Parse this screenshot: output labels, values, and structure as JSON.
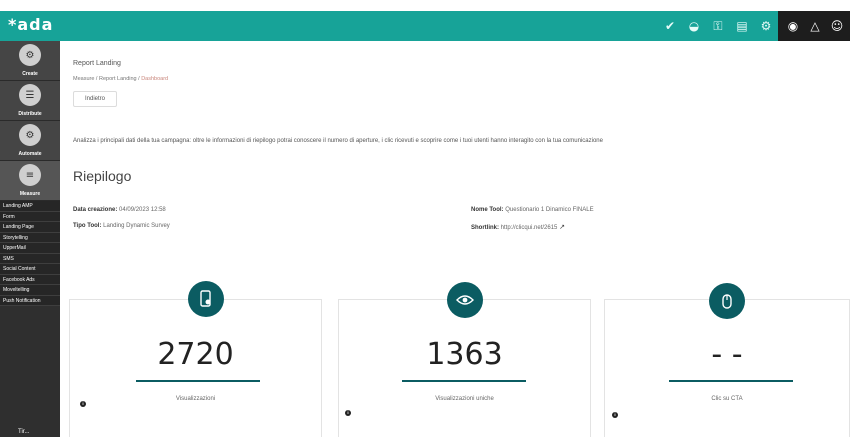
{
  "app": {
    "logo": "*ada"
  },
  "topbar": {
    "icons": [
      "shield-check-icon",
      "dashboard-icon",
      "key-icon",
      "document-icon",
      "gear-icon"
    ],
    "dark_icons": [
      "help-icon",
      "bell-icon",
      "user-icon"
    ]
  },
  "sidebar": {
    "sections": [
      {
        "label": "Create",
        "icon": "palette-icon"
      },
      {
        "label": "Distribute",
        "icon": "list-icon"
      },
      {
        "label": "Automate",
        "icon": "automate-icon"
      },
      {
        "label": "Measure",
        "icon": "measure-icon"
      }
    ],
    "items": [
      "Landing AMP",
      "Form",
      "Landing Page",
      "Storytelling",
      "UpperMail",
      "SMS",
      "Social Content",
      "Facebook Ads",
      "Moveltelling",
      "Push Notification"
    ],
    "bottom_label": "Tir..."
  },
  "page": {
    "title": "Report Landing",
    "breadcrumb": {
      "part1": "Measure / Report Landing / ",
      "current": "Dashboard"
    },
    "back_label": "Indietro",
    "intro": "Analizza i principali dati della tua campagna: oltre le informazioni di riepilogo potrai conoscere il numero di aperture, i clic ricevuti e scoprire come i tuoi utenti hanno interagito con la tua comunicazione",
    "section_title": "Riepilogo"
  },
  "summary": {
    "created_label": "Data creazione:",
    "created_value": "04/09/2023 12:58",
    "type_label": "Tipo Tool:",
    "type_value": "Landing Dynamic Survey",
    "name_label": "Nome Tool:",
    "name_value": "Questionario 1 Dinamico FINALE",
    "shortlink_label": "Shortlink:",
    "shortlink_value": "http://clicqui.net/2615"
  },
  "cards": [
    {
      "value": "2720",
      "label": "Visualizzazioni",
      "icon": "mobile-tap-icon"
    },
    {
      "value": "1363",
      "label": "Visualizzazioni uniche",
      "icon": "eye-icon"
    },
    {
      "value": "- -",
      "label": "Clic su CTA",
      "icon": "mouse-click-icon"
    }
  ],
  "colors": {
    "topbar": "#17a398",
    "accent_dark": "#0b5c62",
    "sidebar": "#2f2f2f"
  }
}
